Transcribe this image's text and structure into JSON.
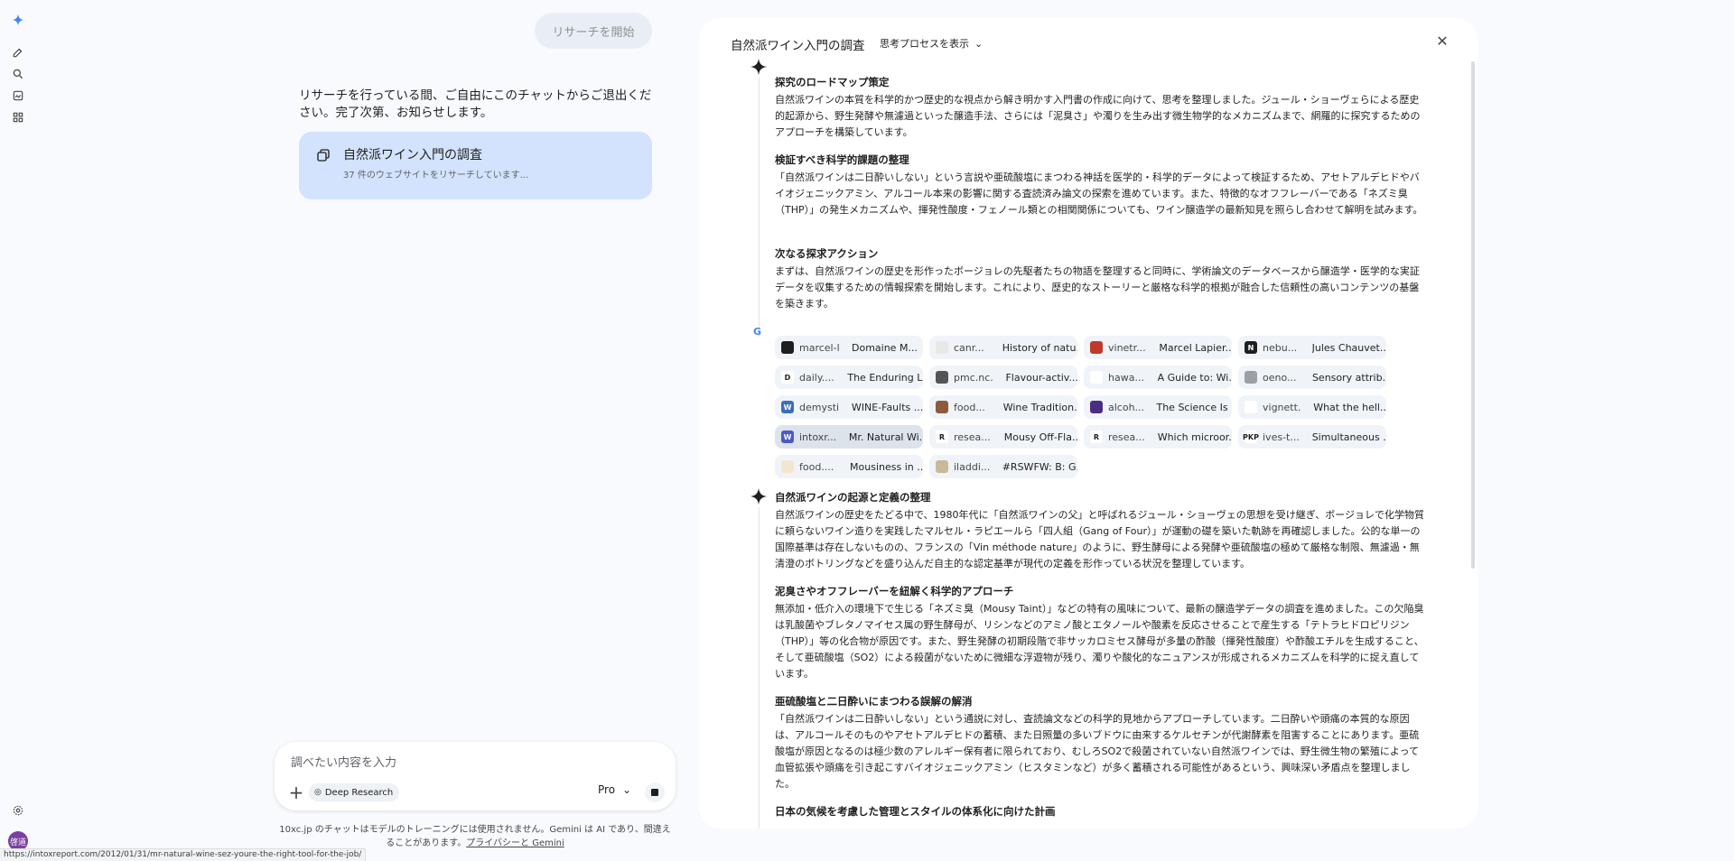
{
  "sidebar": {
    "icons": [
      "gemini-spark-icon",
      "new-chat-icon",
      "search-icon",
      "gallery-icon",
      "apps-icon"
    ],
    "settings_icon": "gear-icon",
    "avatar_label": "啓道"
  },
  "chat": {
    "start_button": "リサーチを開始",
    "message": "リサーチを行っている間、ご自由にこのチャットからご退出ください。完了次第、お知らせします。",
    "card_title": "自然派ワイン入門の調査",
    "card_sub": "37 件のウェブサイトをリサーチしています..."
  },
  "composer": {
    "placeholder": "調べたい内容を入力",
    "chip_label": "Deep Research",
    "model_label": "Pro"
  },
  "disclaimer": {
    "text": "10xc.jp のチャットはモデルのトレーニングには使用されません。Gemini は AI であり、間違えることがあります。",
    "link": "プライバシーと Gemini"
  },
  "status_url": "https://intoxreport.com/2012/01/31/mr-natural-wine-sez-youre-the-right-tool-for-the-job/",
  "panel": {
    "title": "自然派ワイン入門の調査",
    "toggle_label": "思考プロセスを表示",
    "sections": [
      {
        "heading": "探究のロードマップ策定",
        "body": "自然派ワインの本質を科学的かつ歴史的な視点から解き明かす入門書の作成に向けて、思考を整理しました。ジュール・ショーヴェらによる歴史的起源から、野生発酵や無濾過といった醸造手法、さらには「泥臭さ」や濁りを生み出す微生物学的なメカニズムまで、網羅的に探究するためのアプローチを構築しています。"
      },
      {
        "heading": "検証すべき科学的課題の整理",
        "body": "「自然派ワインは二日酔いしない」という言説や亜硫酸塩にまつわる神話を医学的・科学的データによって検証するため、アセトアルデヒドやバイオジェニックアミン、アルコール本来の影響に関する査読済み論文の探索を進めています。また、特徴的なオフフレーバーである「ネズミ臭（THP）」の発生メカニズムや、揮発性酸度・フェノール類との相関関係についても、ワイン醸造学の最新知見を照らし合わせて解明を試みます。"
      },
      {
        "heading": "次なる探求アクション",
        "body": "まずは、自然派ワインの歴史を形作ったボージョレの先駆者たちの物語を整理すると同時に、学術論文のデータベースから醸造学・医学的な実証データを収集するための情報探索を開始します。これにより、歴史的なストーリーと厳格な科学的根拠が融合した信頼性の高いコンテンツの基盤を築きます。"
      },
      {
        "heading": "自然派ワインの起源と定義の整理",
        "body": "自然派ワインの歴史をたどる中で、1980年代に「自然派ワインの父」と呼ばれるジュール・ショーヴェの思想を受け継ぎ、ボージョレで化学物質に頼らないワイン造りを実践したマルセル・ラピエールら「四人組（Gang of Four）」が運動の礎を築いた軌跡を再確認しました。公的な単一の国際基準は存在しないものの、フランスの「Vin méthode nature」のように、野生酵母による発酵や亜硫酸塩の極めて厳格な制限、無濾過・無清澄のボトリングなどを盛り込んだ自主的な認定基準が現代の定義を形作っている状況を整理しています。"
      },
      {
        "heading": "泥臭さやオフフレーバーを紐解く科学的アプローチ",
        "body": "無添加・低介入の環境下で生じる「ネズミ臭（Mousy Taint）」などの特有の風味について、最新の醸造学データの調査を進めました。この欠陥臭は乳酸菌やブレタノマイセス属の野生酵母が、リシンなどのアミノ酸とエタノールや酸素を反応させることで産生する「テトラヒドロピリジン（THP）」等の化合物が原因です。また、野生発酵の初期段階で非サッカロミセス酵母が多量の酢酸（揮発性酸度）や酢酸エチルを生成すること、そして亜硫酸塩（SO2）による殺菌がないために微細な浮遊物が残り、濁りや酸化的なニュアンスが形成されるメカニズムを科学的に捉え直しています。"
      },
      {
        "heading": "亜硫酸塩と二日酔いにまつわる誤解の解消",
        "body": "「自然派ワインは二日酔いしない」という通説に対し、査読論文などの科学的見地からアプローチしています。二日酔いや頭痛の本質的な原因は、アルコールそのものやアセトアルデヒドの蓄積、また日照量の多いブドウに由来するケルセチンが代謝酵素を阻害することにあります。亜硫酸塩が原因となるのは極少数のアレルギー保有者に限られており、むしろSO2で殺菌されていない自然派ワインでは、野生微生物の繁殖によって血管拡張や頭痛を引き起こすバイオジェニックアミン（ヒスタミンなど）が多く蓄積される可能性があるという、興味深い矛盾点を整理しました。"
      },
      {
        "heading": "日本の気候を考慮した管理とスタイルの体系化に向けた計画",
        "body": ""
      }
    ],
    "sources": [
      {
        "domain": "marcel-l...",
        "title": "Domaine M...",
        "fav_color": "#1f1f1f",
        "fav_text": ""
      },
      {
        "domain": "canr...",
        "title": "History of natu...",
        "fav_color": "#e8e8e8",
        "fav_text": ""
      },
      {
        "domain": "vinetr...",
        "title": "Marcel Lapier...",
        "fav_color": "#c0392b",
        "fav_text": ""
      },
      {
        "domain": "nebu...",
        "title": "Jules Chauvet....",
        "fav_color": "#1f1f1f",
        "fav_text": "N"
      },
      {
        "domain": "daily....",
        "title": "The Enduring L...",
        "fav_color": "#ffffff",
        "fav_text": "D"
      },
      {
        "domain": "pmc.nc...",
        "title": "Flavour-activ...",
        "fav_color": "#555555",
        "fav_text": ""
      },
      {
        "domain": "hawa...",
        "title": "A Guide to: Wi...",
        "fav_color": "#ffffff",
        "fav_text": ""
      },
      {
        "domain": "oeno...",
        "title": "Sensory attrib...",
        "fav_color": "#9aa0a6",
        "fav_text": ""
      },
      {
        "domain": "demysti...",
        "title": "WINE-Faults ...",
        "fav_color": "#3b6fb6",
        "fav_text": "W"
      },
      {
        "domain": "food...",
        "title": "Wine Tradition...",
        "fav_color": "#8d5a3b",
        "fav_text": ""
      },
      {
        "domain": "alcoh...",
        "title": "The Science Is ...",
        "fav_color": "#4b2c82",
        "fav_text": ""
      },
      {
        "domain": "vignett...",
        "title": "What the hell...",
        "fav_color": "#ffffff",
        "fav_text": ""
      },
      {
        "domain": "intoxr...",
        "title": "Mr. Natural Wi...",
        "fav_color": "#4a5bc7",
        "fav_text": "W"
      },
      {
        "domain": "resea...",
        "title": "Mousy Off-Fla...",
        "fav_color": "#ffffff",
        "fav_text": "R"
      },
      {
        "domain": "resea...",
        "title": "Which microor...",
        "fav_color": "#ffffff",
        "fav_text": "R"
      },
      {
        "domain": "ives-t...",
        "title": "Simultaneous ...",
        "fav_color": "#ffffff",
        "fav_text": "PKP"
      },
      {
        "domain": "food....",
        "title": "Mousiness in ...",
        "fav_color": "#f3e6d0",
        "fav_text": ""
      },
      {
        "domain": "iladdi...",
        "title": "#RSWFW: B: G...",
        "fav_color": "#c8b99a",
        "fav_text": ""
      }
    ],
    "highlighted_source": 12
  }
}
